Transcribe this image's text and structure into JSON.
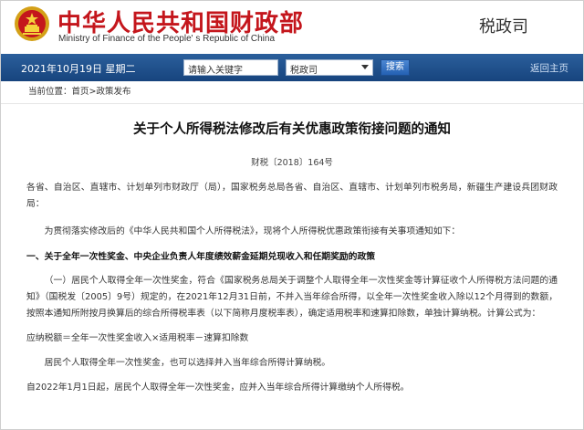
{
  "header": {
    "title_cn": "中华人民共和国财政部",
    "title_en": "Ministry of Finance of the People' s Republic of China",
    "department": "税政司",
    "emblem_icon": "national-emblem-icon",
    "brand_color": "#c4161c"
  },
  "navbar": {
    "date": "2021年10月19日  星期二",
    "search_placeholder": "请输入关键字",
    "scope_select": "税政司",
    "search_button": "搜索",
    "home_link": "返回主页",
    "bar_color": "#1f4f8c"
  },
  "breadcrumb": {
    "text": "当前位置：首页>政策发布"
  },
  "article": {
    "title": "关于个人所得税法修改后有关优惠政策衔接问题的通知",
    "doc_number": "财税〔2018〕164号",
    "p1": "各省、自治区、直辖市、计划单列市财政厅（局），国家税务总局各省、自治区、直辖市、计划单列市税务局，新疆生产建设兵团财政局：",
    "p2": "为贯彻落实修改后的《中华人民共和国个人所得税法》，现将个人所得税优惠政策衔接有关事项通知如下：",
    "p3": "一、关于全年一次性奖金、中央企业负责人年度绩效薪金延期兑现收入和任期奖励的政策",
    "p4": "（一）居民个人取得全年一次性奖金，符合《国家税务总局关于调整个人取得全年一次性奖金等计算征收个人所得税方法问题的通知》（国税发〔2005〕9号）规定的，在2021年12月31日前，不并入当年综合所得，以全年一次性奖金收入除以12个月得到的数额，按照本通知所附按月换算后的综合所得税率表（以下简称月度税率表），确定适用税率和速算扣除数，单独计算纳税。计算公式为：",
    "p5": "应纳税额＝全年一次性奖金收入×适用税率－速算扣除数",
    "p6": "居民个人取得全年一次性奖金，也可以选择并入当年综合所得计算纳税。",
    "p7": "自2022年1月1日起，居民个人取得全年一次性奖金，应并入当年综合所得计算缴纳个人所得税。"
  }
}
